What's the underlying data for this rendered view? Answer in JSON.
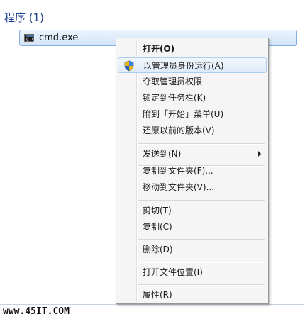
{
  "section": {
    "header": "程序 (1)"
  },
  "result": {
    "label": "cmd.exe",
    "icon": "console-icon"
  },
  "context_menu": {
    "items": [
      {
        "label": "打开(O)",
        "bold": true
      },
      {
        "label": "以管理员身份运行(A)",
        "icon": "uac-shield-icon",
        "highlighted": true
      },
      {
        "label": "夺取管理员权限"
      },
      {
        "label": "锁定到任务栏(K)"
      },
      {
        "label": "附到「开始」菜单(U)"
      },
      {
        "label": "还原以前的版本(V)"
      },
      {
        "label": "发送到(N)",
        "submenu": true
      },
      {
        "label": "复制到文件夹(F)..."
      },
      {
        "label": "移动到文件夹(V)..."
      },
      {
        "label": "剪切(T)"
      },
      {
        "label": "复制(C)"
      },
      {
        "label": "删除(D)"
      },
      {
        "label": "打开文件位置(I)"
      },
      {
        "label": "属性(R)"
      }
    ]
  },
  "watermark": "www.45IT.COM",
  "colors": {
    "header_text": "#1e3f8a",
    "selection_border": "#84acdd",
    "menu_background": "#f5f5f5",
    "menu_border": "#979797"
  }
}
